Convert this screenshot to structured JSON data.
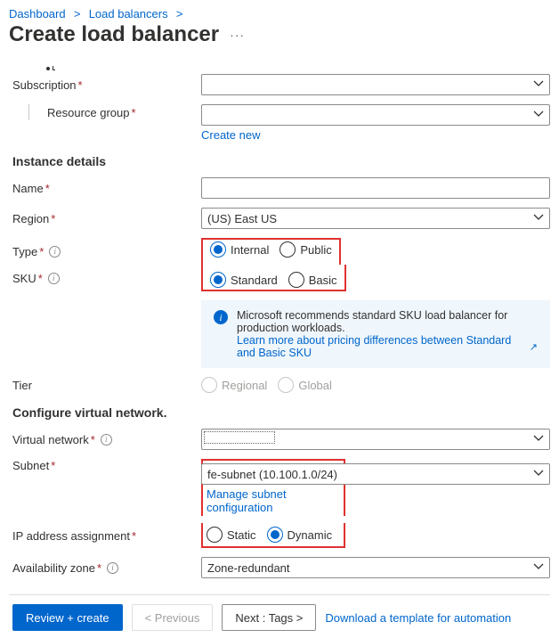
{
  "breadcrumb": {
    "dashboard": "Dashboard",
    "load_balancers": "Load balancers"
  },
  "page_title": "Create load balancer",
  "basics": {
    "subscription": {
      "label": "Subscription",
      "value": ""
    },
    "resource_group": {
      "label": "Resource group",
      "value": "",
      "create_new": "Create new"
    }
  },
  "instance": {
    "heading": "Instance details",
    "name": {
      "label": "Name",
      "value": ""
    },
    "region": {
      "label": "Region",
      "value": "(US) East US"
    },
    "type": {
      "label": "Type",
      "options": [
        "Internal",
        "Public"
      ],
      "selected": "Internal"
    },
    "sku": {
      "label": "SKU",
      "options": [
        "Standard",
        "Basic"
      ],
      "selected": "Standard"
    },
    "info": {
      "text": "Microsoft recommends standard SKU load balancer for production workloads.",
      "link": "Learn more about pricing differences between Standard and Basic SKU"
    },
    "tier": {
      "label": "Tier",
      "options": [
        "Regional",
        "Global"
      ],
      "selected": null
    }
  },
  "vnet": {
    "heading": "Configure virtual network.",
    "virtual_network": {
      "label": "Virtual network",
      "value": ""
    },
    "subnet": {
      "label": "Subnet",
      "value": "fe-subnet (10.100.1.0/24)",
      "manage": "Manage subnet configuration"
    },
    "ip_assignment": {
      "label": "IP address assignment",
      "options": [
        "Static",
        "Dynamic"
      ],
      "selected": "Dynamic"
    },
    "availability_zone": {
      "label": "Availability zone",
      "value": "Zone-redundant"
    }
  },
  "footer": {
    "review": "Review + create",
    "previous": "< Previous",
    "next": "Next : Tags >",
    "download": "Download a template for automation"
  }
}
